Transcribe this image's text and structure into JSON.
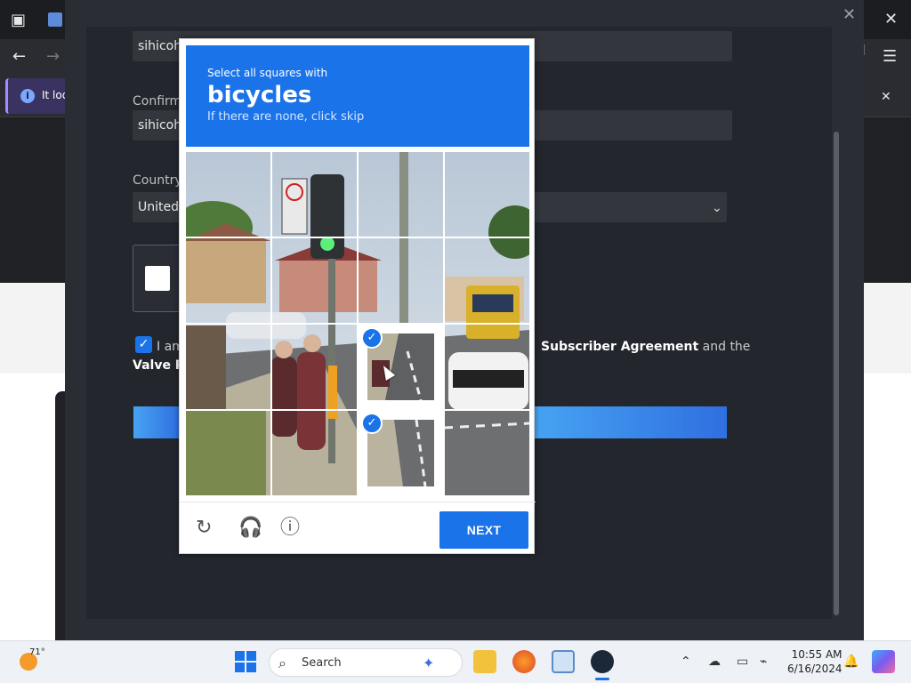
{
  "browser": {
    "info_text": "It loo"
  },
  "form": {
    "email_value": "sihicoh",
    "confirm_label": "Confirm",
    "confirm_value": "sihicoh",
    "country_label": "Country",
    "country_value": "United",
    "agree_text_left": "I am",
    "agree_subscriber": "Subscriber Agreement",
    "agree_and_the": "and the",
    "agree_line2": "Valve Pr"
  },
  "captcha": {
    "instruction_line1": "Select all squares with",
    "target": "bicycles",
    "instruction_line3": "If there are none, click skip",
    "next_label": "NEXT",
    "selected_tiles": [
      10,
      14
    ],
    "colors": {
      "accent": "#1a73e8"
    }
  },
  "taskbar": {
    "weather_temp": "71°",
    "search_placeholder": "Search",
    "time": "10:55 AM",
    "date": "6/16/2024"
  }
}
